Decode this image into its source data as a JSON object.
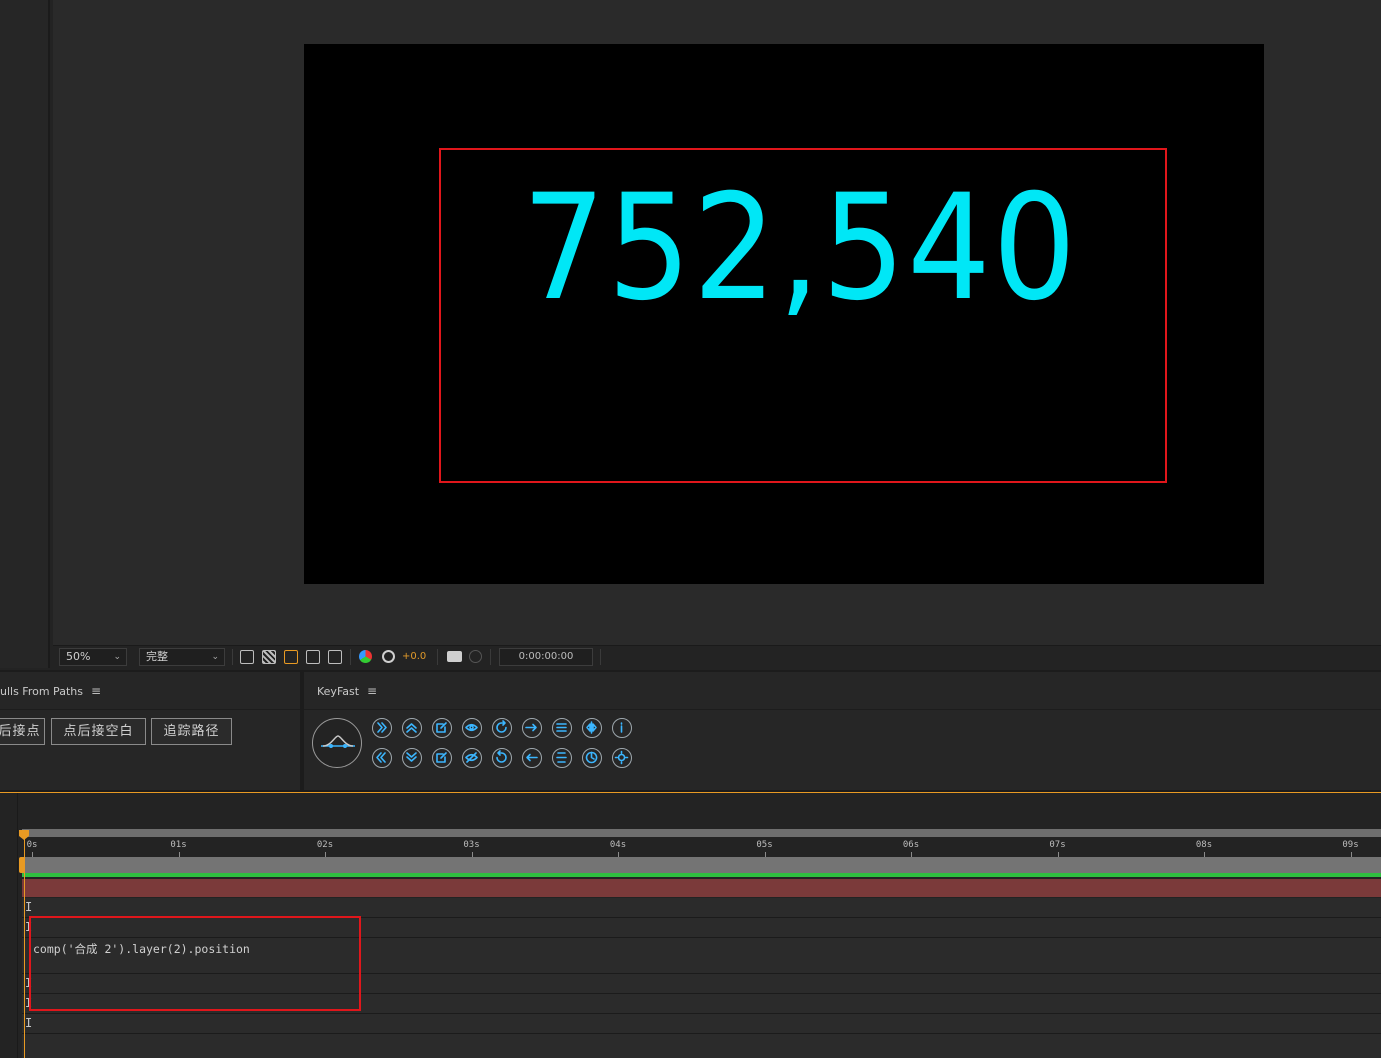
{
  "viewer": {
    "counter_text": "752,540",
    "accent_color": "#00e7f6",
    "highlight_color": "#e0161b"
  },
  "viewer_toolbar": {
    "zoom": "50%",
    "resolution": "完整",
    "exposure": "+0.0",
    "timecode": "0:00:00:00"
  },
  "panels": {
    "nulls_title": "ulls From Paths",
    "nulls_buttons": [
      "后接点",
      "点后接空白",
      "追踪路径"
    ],
    "keyfast_title": "KeyFast",
    "keyfast_icons_top": [
      "fast-forward-icon",
      "chevron-up-icon",
      "edit-out-icon",
      "eye-icon",
      "rotate-cw-icon",
      "arrow-right-icon",
      "align-icon",
      "mirror-icon",
      "info-icon"
    ],
    "keyfast_icons_bottom": [
      "rewind-icon",
      "chevron-down-icon",
      "edit-in-icon",
      "eye-off-icon",
      "rotate-ccw-icon",
      "arrow-left-icon",
      "distribute-icon",
      "clock-icon",
      "settings-icon"
    ]
  },
  "timeline": {
    "ruler_labels": [
      "0s",
      "01s",
      "02s",
      "03s",
      "04s",
      "05s",
      "06s",
      "07s",
      "08s",
      "09s"
    ],
    "expression": "comp('合成 2').layer(2).position",
    "row_marker": "I"
  }
}
